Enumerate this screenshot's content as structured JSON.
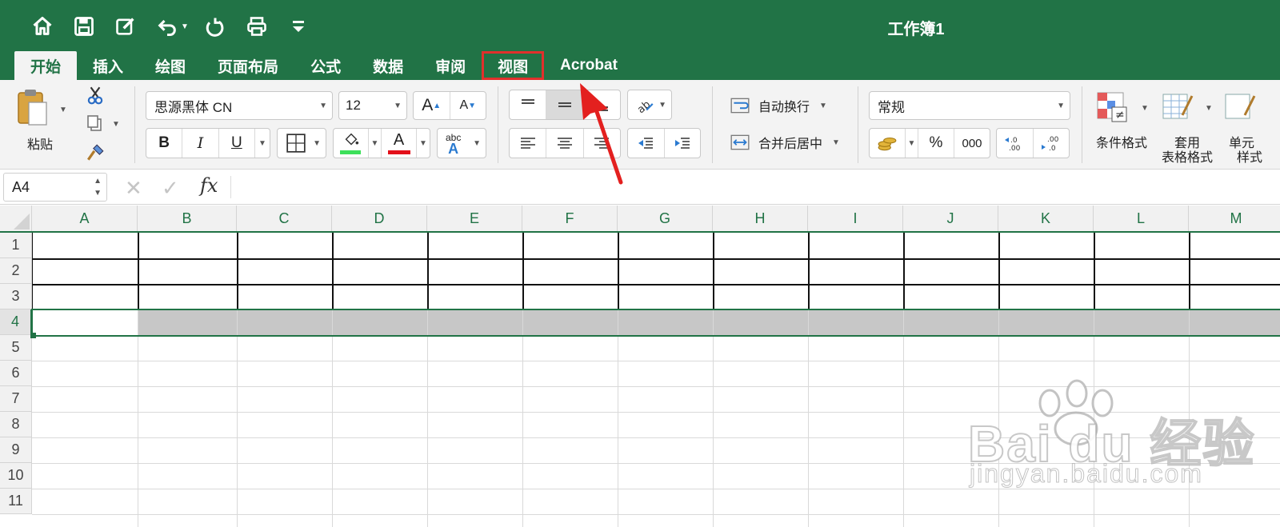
{
  "window": {
    "title": "工作簿1"
  },
  "quick_access": {
    "icons": [
      "home-icon",
      "save-icon",
      "edit-icon",
      "undo-icon",
      "redo-icon",
      "print-icon",
      "customize-icon"
    ]
  },
  "tabs": [
    {
      "label": "开始",
      "active": true
    },
    {
      "label": "插入"
    },
    {
      "label": "绘图"
    },
    {
      "label": "页面布局"
    },
    {
      "label": "公式"
    },
    {
      "label": "数据"
    },
    {
      "label": "审阅"
    },
    {
      "label": "视图",
      "highlighted": true
    },
    {
      "label": "Acrobat"
    }
  ],
  "ribbon": {
    "paste_label": "粘贴",
    "font_name": "思源黑体 CN",
    "font_size": "12",
    "bold": "B",
    "italic": "I",
    "underline": "U",
    "font_color_letter": "A",
    "abc": "abc",
    "wrap_text_label": "自动换行",
    "merge_center_label": "合并后居中",
    "number_format": "常规",
    "percent": "%",
    "thousands": "000",
    "conditional_format_label": "条件格式",
    "table_format_label_1": "套用",
    "table_format_label_2": "表格格式",
    "cell_style_label_1": "单元",
    "cell_style_label_2": "样式",
    "colors": {
      "fill": "#3de05a",
      "font": "#e3101a",
      "accent": "#217346"
    }
  },
  "formula_bar": {
    "name_box": "A4",
    "fx": "fx",
    "value": ""
  },
  "sheet": {
    "columns": [
      "A",
      "B",
      "C",
      "D",
      "E",
      "F",
      "G",
      "H",
      "I",
      "J",
      "K",
      "L",
      "M"
    ],
    "rows": [
      "1",
      "2",
      "3",
      "4",
      "5",
      "6",
      "7",
      "8",
      "9",
      "10",
      "11"
    ],
    "selected_row": "4",
    "active_cell": "A4"
  },
  "watermark": {
    "brand": "Bai du 经验",
    "url": "jingyan.baidu.com"
  }
}
